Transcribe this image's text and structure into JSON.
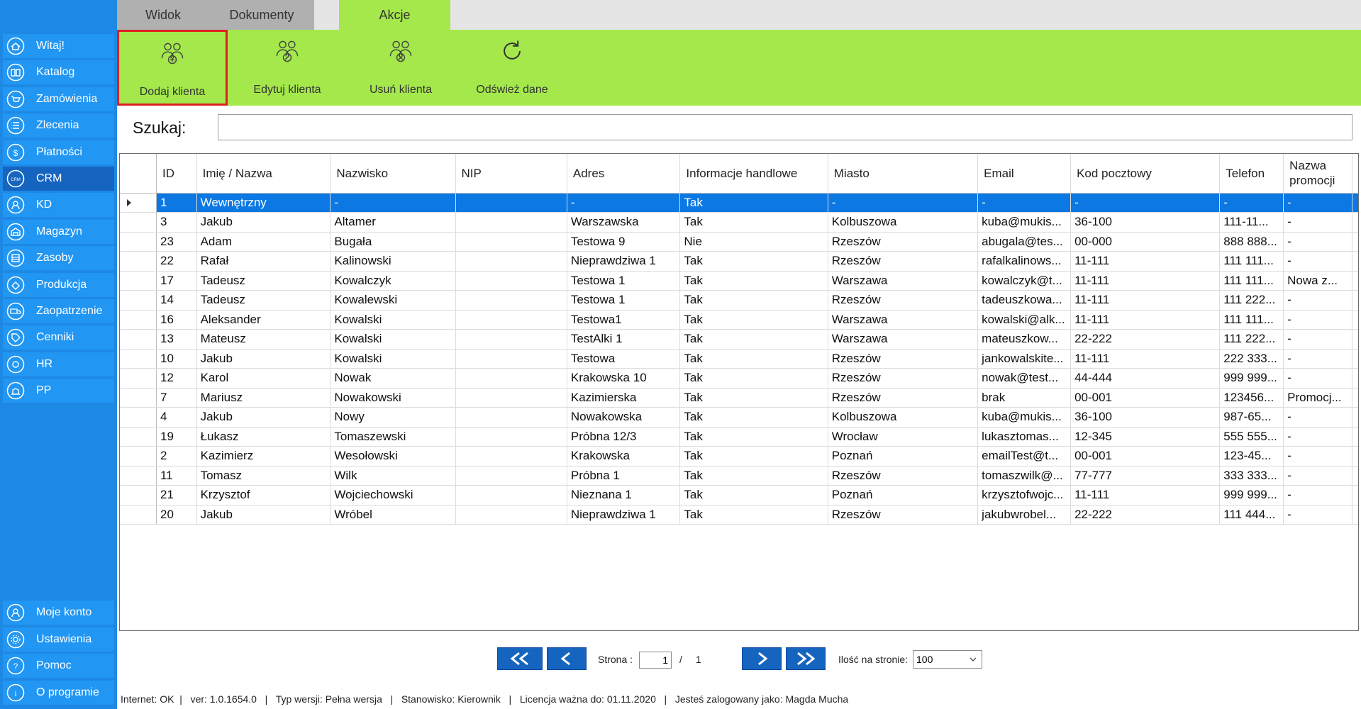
{
  "sidebar": {
    "items": [
      {
        "label": "Witaj!",
        "icon": "home-icon",
        "active": false
      },
      {
        "label": "Katalog",
        "icon": "book-icon",
        "active": false
      },
      {
        "label": "Zamówienia",
        "icon": "cart-icon",
        "active": false
      },
      {
        "label": "Zlecenia",
        "icon": "list-icon",
        "active": false
      },
      {
        "label": "Płatności",
        "icon": "dollar-icon",
        "active": false
      },
      {
        "label": "CRM",
        "icon": "crm-icon",
        "active": true
      },
      {
        "label": "KD",
        "icon": "user-icon",
        "active": false
      },
      {
        "label": "Magazyn",
        "icon": "warehouse-icon",
        "active": false
      },
      {
        "label": "Zasoby",
        "icon": "resources-icon",
        "active": false
      },
      {
        "label": "Produkcja",
        "icon": "production-icon",
        "active": false
      },
      {
        "label": "Zaopatrzenie",
        "icon": "truck-icon",
        "active": false
      },
      {
        "label": "Cenniki",
        "icon": "tag-icon",
        "active": false
      },
      {
        "label": "HR",
        "icon": "hr-icon",
        "active": false
      },
      {
        "label": "PP",
        "icon": "pp-icon",
        "active": false
      }
    ],
    "bottom_items": [
      {
        "label": "Moje konto",
        "icon": "account-icon"
      },
      {
        "label": "Ustawienia",
        "icon": "settings-icon"
      },
      {
        "label": "Pomoc",
        "icon": "help-icon"
      },
      {
        "label": "O programie",
        "icon": "info-icon"
      }
    ]
  },
  "tabs": [
    {
      "label": "Widok",
      "active": false
    },
    {
      "label": "Dokumenty",
      "active": false
    },
    {
      "label": "Akcje",
      "active": true
    }
  ],
  "ribbon": {
    "buttons": [
      {
        "label": "Dodaj klienta",
        "icon": "add-client-icon",
        "selected": true
      },
      {
        "label": "Edytuj klienta",
        "icon": "edit-client-icon",
        "selected": false
      },
      {
        "label": "Usuń klienta",
        "icon": "delete-client-icon",
        "selected": false
      },
      {
        "label": "Odśwież dane",
        "icon": "refresh-icon",
        "selected": false
      }
    ]
  },
  "search": {
    "label": "Szukaj:",
    "value": ""
  },
  "grid": {
    "columns": [
      "ID",
      "Imię / Nazwa",
      "Nazwisko",
      "NIP",
      "Adres",
      "Informacje handlowe",
      "Miasto",
      "Email",
      "Kod pocztowy",
      "Telefon",
      "Nazwa promocji"
    ],
    "selected_row": 0,
    "rows": [
      [
        "1",
        "Wewnętrzny",
        "-",
        "",
        "-",
        "Tak",
        "-",
        "-",
        "-",
        "-",
        "-"
      ],
      [
        "3",
        "Jakub",
        "Altamer",
        "",
        "Warszawska",
        "Tak",
        "Kolbuszowa",
        "kuba@mukis...",
        "36-100",
        "111-11...",
        "-"
      ],
      [
        "23",
        "Adam",
        "Bugała",
        "",
        "Testowa 9",
        "Nie",
        "Rzeszów",
        "abugala@tes...",
        "00-000",
        "888 888...",
        "-"
      ],
      [
        "22",
        "Rafał",
        "Kalinowski",
        "",
        "Nieprawdziwa 1",
        "Tak",
        "Rzeszów",
        "rafalkalinows...",
        "11-111",
        "111 111...",
        "-"
      ],
      [
        "17",
        "Tadeusz",
        "Kowalczyk",
        "",
        "Testowa 1",
        "Tak",
        "Warszawa",
        "kowalczyk@t...",
        "11-111",
        "111 111...",
        "Nowa z..."
      ],
      [
        "14",
        "Tadeusz",
        "Kowalewski",
        "",
        "Testowa 1",
        "Tak",
        "Rzeszów",
        "tadeuszkowa...",
        "11-111",
        "111 222...",
        "-"
      ],
      [
        "16",
        "Aleksander",
        "Kowalski",
        "",
        "Testowa1",
        "Tak",
        "Warszawa",
        "kowalski@alk...",
        "11-111",
        "111 111...",
        "-"
      ],
      [
        "13",
        "Mateusz",
        "Kowalski",
        "",
        "TestAlki 1",
        "Tak",
        "Warszawa",
        "mateuszkow...",
        "22-222",
        "111 222...",
        "-"
      ],
      [
        "10",
        "Jakub",
        "Kowalski",
        "",
        "Testowa",
        "Tak",
        "Rzeszów",
        "jankowalskite...",
        "11-111",
        "222 333...",
        "-"
      ],
      [
        "12",
        "Karol",
        "Nowak",
        "",
        "Krakowska 10",
        "Tak",
        "Rzeszów",
        "nowak@test...",
        "44-444",
        "999 999...",
        "-"
      ],
      [
        "7",
        "Mariusz",
        "Nowakowski",
        "",
        "Kazimierska",
        "Tak",
        "Rzeszów",
        "brak",
        "00-001",
        "123456...",
        "Promocj..."
      ],
      [
        "4",
        "Jakub",
        "Nowy",
        "",
        "Nowakowska",
        "Tak",
        "Kolbuszowa",
        "kuba@mukis...",
        "36-100",
        "987-65...",
        "-"
      ],
      [
        "19",
        "Łukasz",
        "Tomaszewski",
        "",
        "Próbna 12/3",
        "Tak",
        "Wrocław",
        "lukasztomas...",
        "12-345",
        "555 555...",
        "-"
      ],
      [
        "2",
        "Kazimierz",
        "Wesołowski",
        "",
        "Krakowska",
        "Tak",
        "Poznań",
        "emailTest@t...",
        "00-001",
        "123-45...",
        "-"
      ],
      [
        "11",
        "Tomasz",
        "Wilk",
        "",
        "Próbna 1",
        "Tak",
        "Rzeszów",
        "tomaszwilk@...",
        "77-777",
        "333 333...",
        "-"
      ],
      [
        "21",
        "Krzysztof",
        "Wojciechowski",
        "",
        "Nieznana 1",
        "Tak",
        "Poznań",
        "krzysztofwojc...",
        "11-111",
        "999 999...",
        "-"
      ],
      [
        "20",
        "Jakub",
        "Wróbel",
        "",
        "Nieprawdziwa 1",
        "Tak",
        "Rzeszów",
        "jakubwrobel...",
        "22-222",
        "111 444...",
        "-"
      ]
    ]
  },
  "pager": {
    "page_label": "Strona :",
    "current_page": "1",
    "separator": "/",
    "total_pages": "1",
    "per_page_label": "Ilość na stronie:",
    "per_page_value": "100"
  },
  "status": {
    "text": "Internet: OK  |   ver: 1.0.1654.0   |   Typ wersji: Pełna wersja   |   Stanowisko: Kierownik   |   Licencja ważna do: 01.11.2020   |   Jesteś zalogowany jako: Magda Mucha"
  },
  "colors": {
    "sidebar": "#1e88e5",
    "sidebar_item": "#2196f3",
    "sidebar_active": "#1565c0",
    "ribbon": "#a4e84b",
    "selection": "#0b78e3",
    "highlight_border": "#e01f1f"
  }
}
